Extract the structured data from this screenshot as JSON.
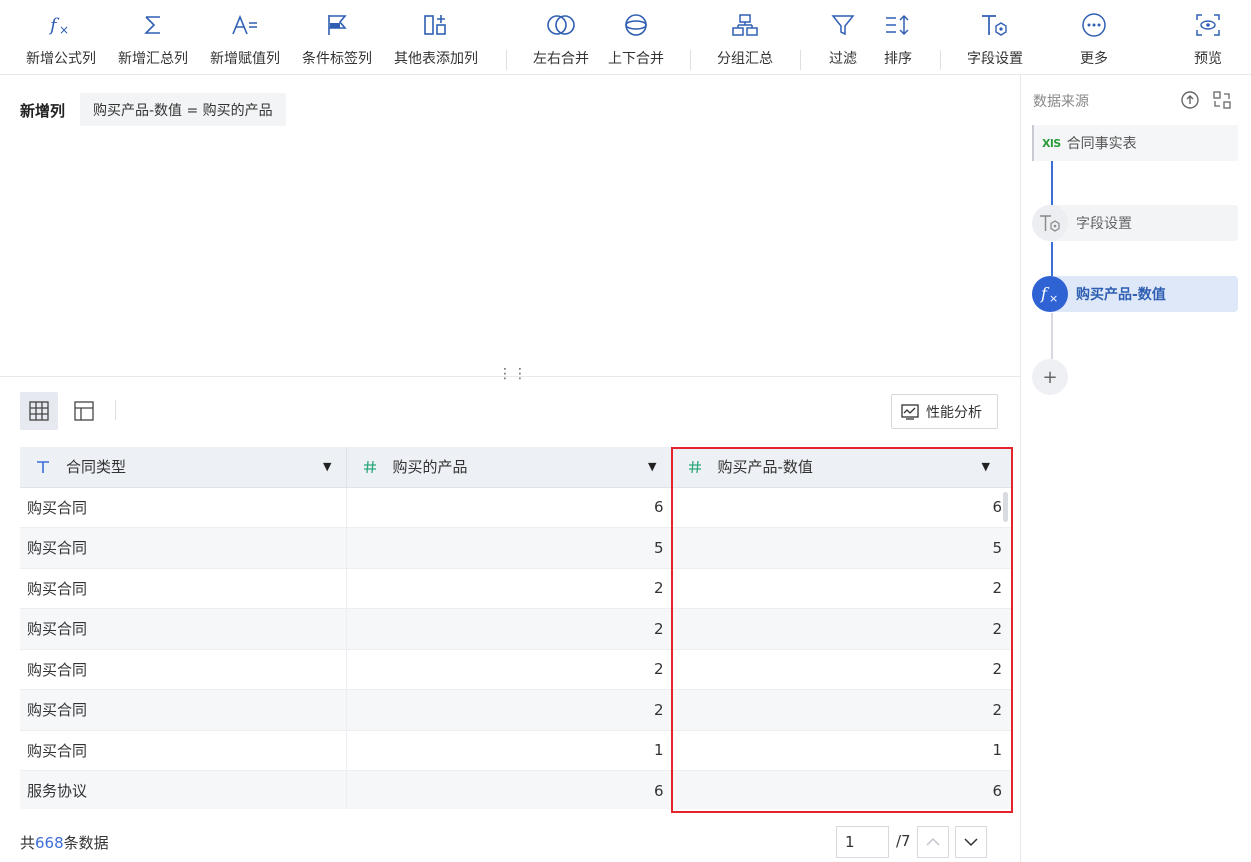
{
  "toolbar": {
    "items": [
      {
        "label": "新增公式列",
        "icon": "formula-icon"
      },
      {
        "label": "新增汇总列",
        "icon": "sum-icon"
      },
      {
        "label": "新增赋值列",
        "icon": "assign-icon"
      },
      {
        "label": "条件标签列",
        "icon": "flag-icon"
      },
      {
        "label": "其他表添加列",
        "icon": "add-column-icon"
      },
      {
        "label": "左右合并",
        "icon": "merge-horizontal-icon"
      },
      {
        "label": "上下合并",
        "icon": "merge-vertical-icon"
      },
      {
        "label": "分组汇总",
        "icon": "group-icon"
      },
      {
        "label": "过滤",
        "icon": "filter-icon"
      },
      {
        "label": "排序",
        "icon": "sort-icon"
      },
      {
        "label": "字段设置",
        "icon": "field-settings-icon"
      },
      {
        "label": "更多",
        "icon": "more-icon"
      },
      {
        "label": "预览",
        "icon": "preview-icon"
      }
    ]
  },
  "formula": {
    "label": "新增列",
    "expression": "购买产品-数值 = 购买的产品"
  },
  "view": {
    "perf_label": "性能分析"
  },
  "table": {
    "columns": [
      {
        "name": "合同类型",
        "type": "text"
      },
      {
        "name": "购买的产品",
        "type": "number"
      },
      {
        "name": "购买产品-数值",
        "type": "number"
      }
    ],
    "rows": [
      [
        "购买合同",
        "6",
        "6"
      ],
      [
        "购买合同",
        "5",
        "5"
      ],
      [
        "购买合同",
        "2",
        "2"
      ],
      [
        "购买合同",
        "2",
        "2"
      ],
      [
        "购买合同",
        "2",
        "2"
      ],
      [
        "购买合同",
        "2",
        "2"
      ],
      [
        "购买合同",
        "1",
        "1"
      ],
      [
        "服务协议",
        "6",
        "6"
      ]
    ]
  },
  "footer": {
    "prefix": "共",
    "count": "668",
    "suffix": "条数据",
    "page_value": "1",
    "page_total": "/7"
  },
  "right_panel": {
    "title": "数据来源",
    "source_badge": "XlS",
    "source_name": "合同事实表",
    "step1": "字段设置",
    "step2": "购买产品-数值",
    "add": "+"
  },
  "colors": {
    "accent": "#3b6ed8",
    "highlight": "#e3252b",
    "xls": "#2a9c3b"
  }
}
